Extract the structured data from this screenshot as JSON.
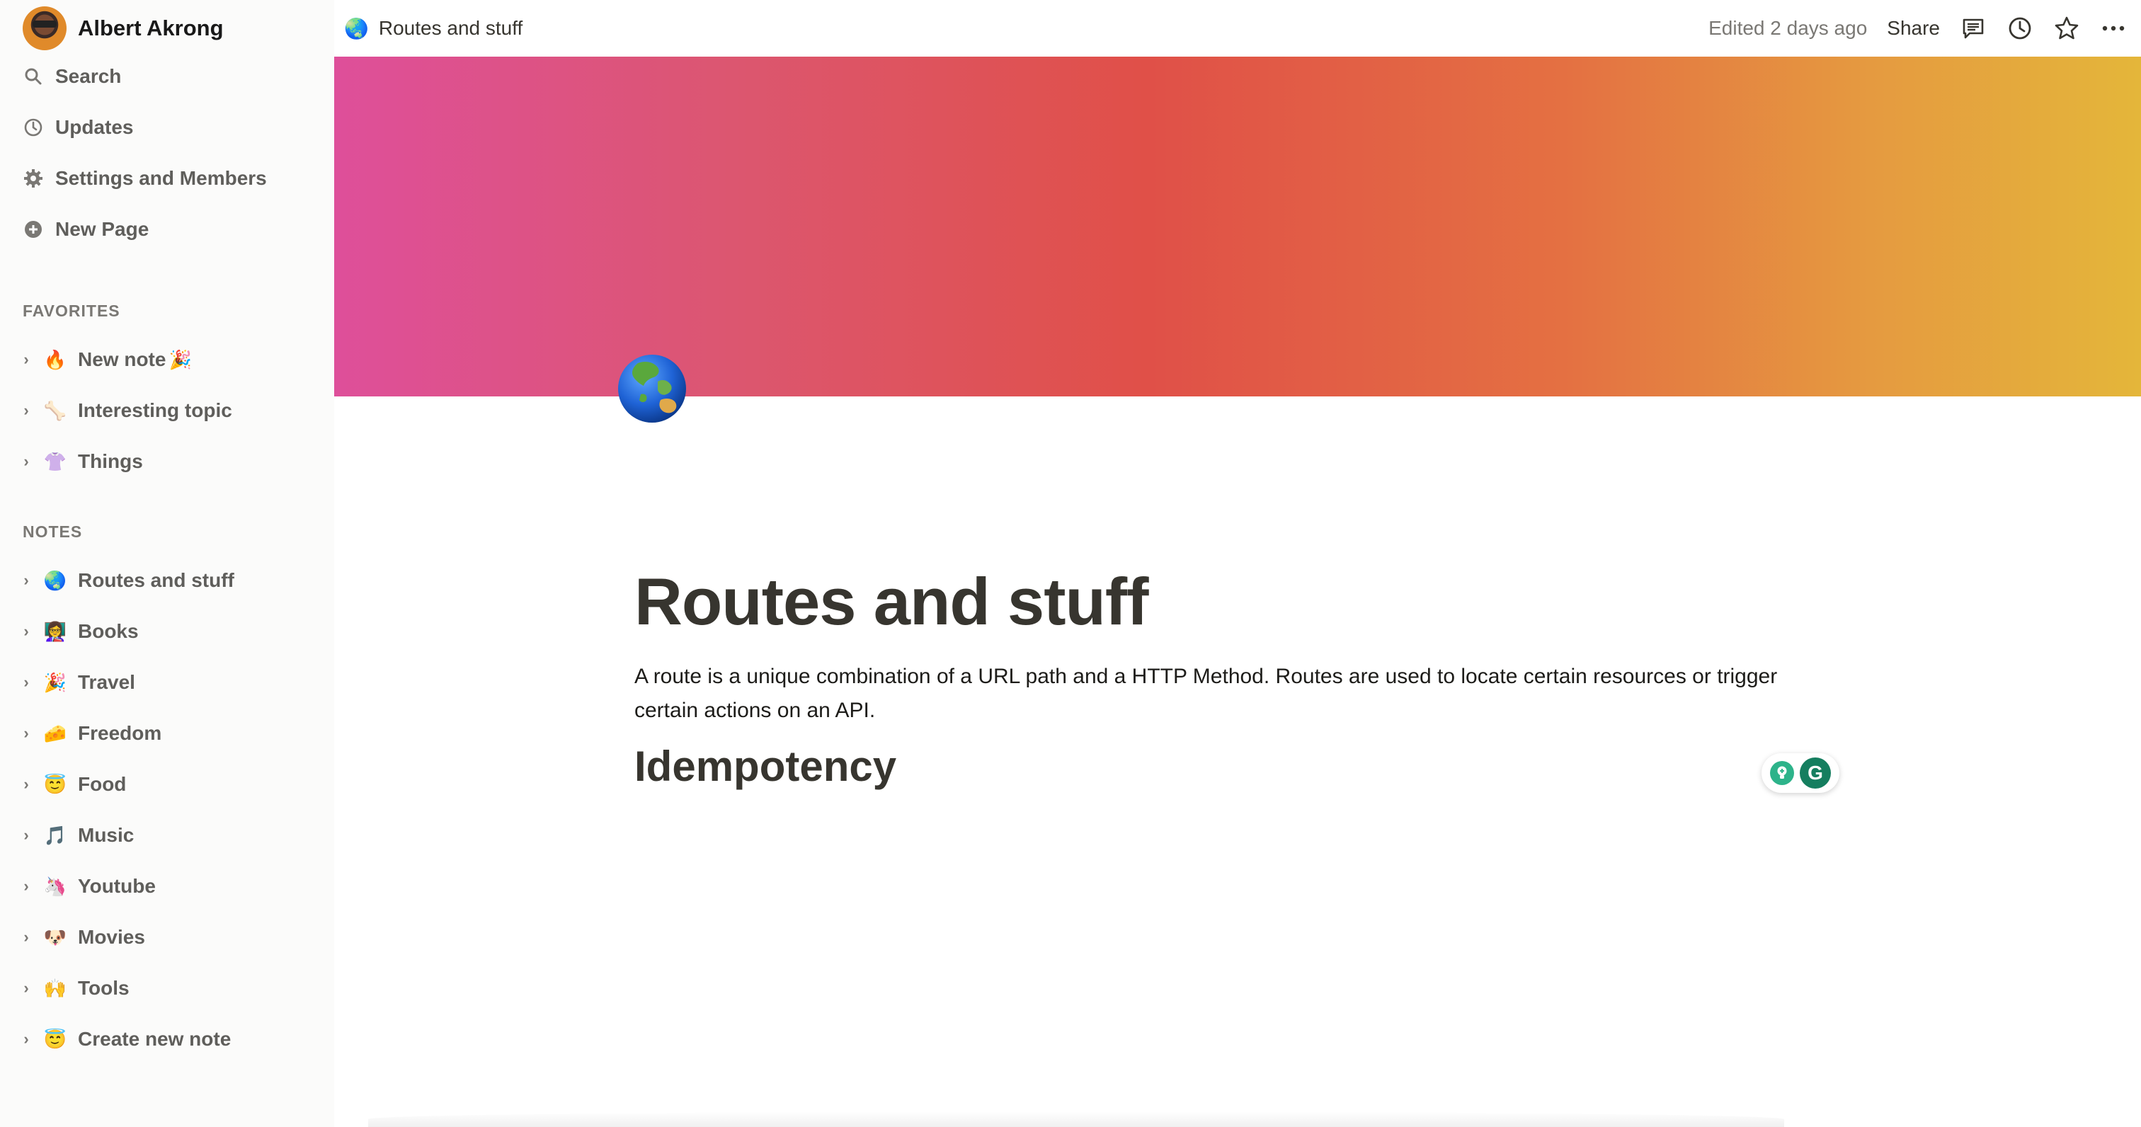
{
  "sidebar": {
    "workspace_name": "Albert Akrong",
    "nav": [
      {
        "label": "Search",
        "icon": "search-icon"
      },
      {
        "label": "Updates",
        "icon": "clock-icon"
      },
      {
        "label": "Settings and Members",
        "icon": "gear-icon"
      },
      {
        "label": "New Page",
        "icon": "plus-circle-icon"
      }
    ],
    "favorites_label": "FAVORITES",
    "favorites": [
      {
        "emoji": "🔥",
        "label": "New note",
        "trail": "🎉"
      },
      {
        "emoji": "🦴",
        "label": "Interesting topic"
      },
      {
        "emoji": "👚",
        "label": "Things"
      }
    ],
    "notes_label": "NOTES",
    "notes": [
      {
        "emoji": "🌏",
        "label": "Routes and stuff"
      },
      {
        "emoji": "👩‍🏫",
        "label": "Books"
      },
      {
        "emoji": "🎉",
        "label": "Travel"
      },
      {
        "emoji": "🧀",
        "label": "Freedom"
      },
      {
        "emoji": "😇",
        "label": "Food"
      },
      {
        "emoji": "🎵",
        "label": "Music"
      },
      {
        "emoji": "🦄",
        "label": "Youtube"
      },
      {
        "emoji": "🐶",
        "label": "Movies"
      },
      {
        "emoji": "🙌",
        "label": "Tools"
      },
      {
        "emoji": "😇",
        "label": "Create new note"
      }
    ]
  },
  "topbar": {
    "breadcrumb_emoji": "🌏",
    "breadcrumb": "Routes and stuff",
    "edited": "Edited 2 days ago",
    "share": "Share"
  },
  "page": {
    "icon_emoji": "🌏",
    "title": "Routes and stuff",
    "paragraph": "A route is a unique combination of a URL path and a HTTP Method. Routes are used to locate certain resources or trigger certain actions on an API.",
    "heading": "Idempotency",
    "grammarly_letter": "G"
  },
  "colors": {
    "cover_gradient": [
      "#de4f9a",
      "#e05048",
      "#e4b63a"
    ],
    "sidebar_bg": "#fbfbfa",
    "text": "#37352f"
  }
}
